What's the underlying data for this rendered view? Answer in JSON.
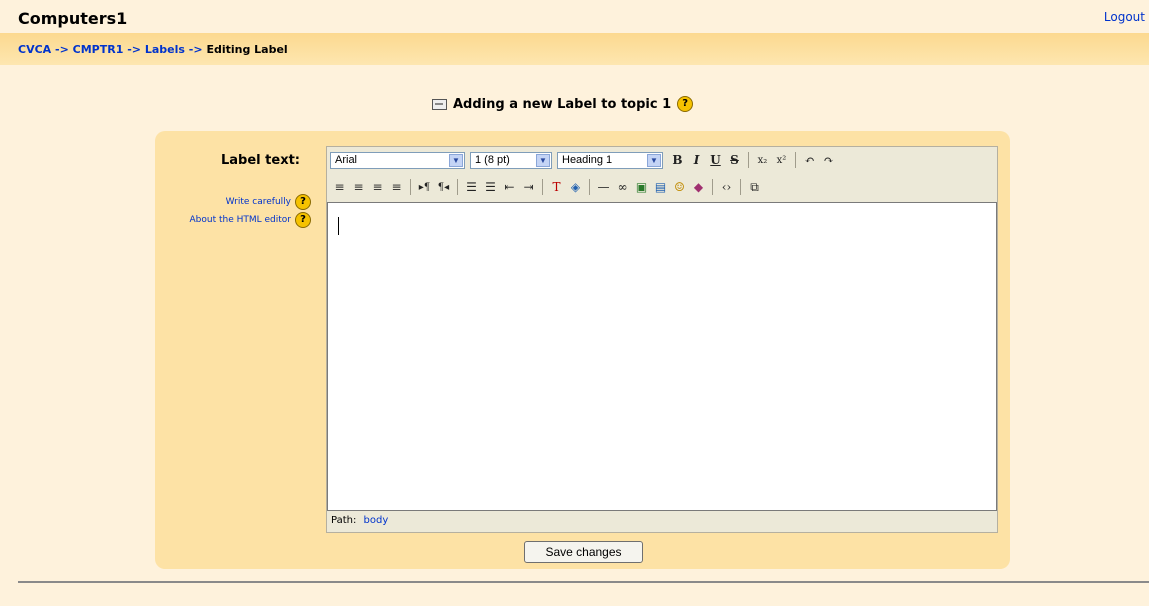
{
  "header": {
    "title": "Computers1",
    "logout": "Logout"
  },
  "breadcrumb": {
    "items": [
      "CVCA",
      "CMPTR1",
      "Labels"
    ],
    "current": "Editing Label",
    "separator": "->"
  },
  "page": {
    "heading": "Adding a new Label to topic 1"
  },
  "form": {
    "field_label": "Label text:",
    "help_links": [
      "Write carefully",
      "About the HTML editor"
    ],
    "save_label": "Save changes"
  },
  "editor": {
    "font": "Arial",
    "size": "1 (8 pt)",
    "format": "Heading 1",
    "path_label": "Path:",
    "path_value": "body"
  },
  "colors": {
    "link": "#0033cc",
    "background": "#fef2dc",
    "box": "#fde2a5",
    "help": "#f6c200"
  }
}
